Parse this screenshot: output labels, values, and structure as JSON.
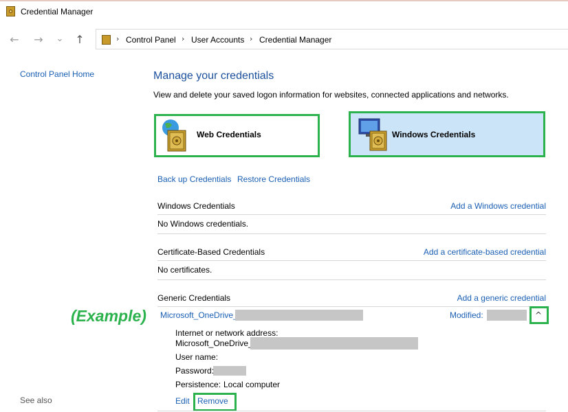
{
  "window": {
    "title": "Credential Manager"
  },
  "nav": {
    "back_icon": "←",
    "forward_icon": "→",
    "recent_icon": "⌄",
    "up_icon": "↑"
  },
  "breadcrumb": {
    "items": [
      "Control Panel",
      "User Accounts",
      "Credential Manager"
    ],
    "separator": "›",
    "first_separator": "›"
  },
  "sidebar": {
    "home_link": "Control Panel Home",
    "see_also": "See also"
  },
  "main": {
    "heading": "Manage your credentials",
    "description": "View and delete your saved logon information for websites, connected applications and networks.",
    "web_credentials_label": "Web Credentials",
    "windows_credentials_label": "Windows Credentials",
    "backup_link": "Back up Credentials",
    "restore_link": "Restore Credentials"
  },
  "sections": {
    "windows": {
      "title": "Windows Credentials",
      "action": "Add a Windows credential",
      "empty": "No Windows credentials."
    },
    "certificate": {
      "title": "Certificate-Based Credentials",
      "action": "Add a certificate-based credential",
      "empty": "No certificates."
    },
    "generic": {
      "title": "Generic Credentials",
      "action": "Add a generic credential",
      "item_name": "Microsoft_OneDrive_",
      "modified_label": "Modified:",
      "expand_icon": "^",
      "address_label": "Internet or network address:",
      "address_value": "Microsoft_OneDrive_",
      "username_label": "User name:",
      "password_label": "Password:",
      "persistence_label": "Persistence:",
      "persistence_value": "Local computer",
      "edit_link": "Edit",
      "remove_link": "Remove"
    }
  },
  "annotation": {
    "example_text": "(Example)",
    "highlight_color": "#2bb24c"
  },
  "colors": {
    "link": "#1a5fb4",
    "heading": "#1a4f9c",
    "selected_bg": "#cce4f7"
  }
}
